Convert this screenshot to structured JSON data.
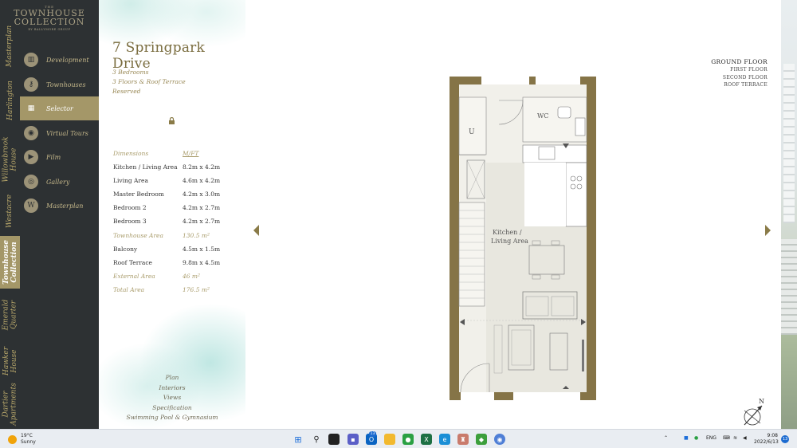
{
  "brand": {
    "top": "THE",
    "name_line1": "TOWNHOUSE",
    "name_line2": "COLLECTION",
    "byline": "BY BALLYMORE GROUP"
  },
  "rail": [
    {
      "label": "Masterplan"
    },
    {
      "label": "Harlington"
    },
    {
      "label": "Willowbrook House"
    },
    {
      "label": "Westacre"
    },
    {
      "label": "Townhouse Collection",
      "active": true
    },
    {
      "label": "Emerald Quarter"
    },
    {
      "label": "Hawker House"
    },
    {
      "label": "Dartier Apartments"
    }
  ],
  "menu": [
    {
      "label": "Development",
      "icon": "building-icon"
    },
    {
      "label": "Townhouses",
      "icon": "key-icon"
    },
    {
      "label": "Selector",
      "icon": "grid-icon",
      "active": true
    },
    {
      "label": "Virtual Tours",
      "icon": "vr-headset-icon"
    },
    {
      "label": "Film",
      "icon": "film-icon"
    },
    {
      "label": "Gallery",
      "icon": "camera-icon"
    },
    {
      "label": "Masterplan",
      "icon": "w-logo-icon"
    }
  ],
  "property": {
    "title": "7 Springpark Drive",
    "bedrooms": "3 Bedrooms",
    "floors": "3 Floors & Roof Terrace",
    "status": "Reserved"
  },
  "dimensions": {
    "header_key": "Dimensions",
    "header_val": "M/FT",
    "rows": [
      {
        "k": "Kitchen / Living Area",
        "v": "8.2m x 4.2m"
      },
      {
        "k": "Living Area",
        "v": "4.6m x 4.2m"
      },
      {
        "k": "Master Bedroom",
        "v": "4.2m x 3.0m"
      },
      {
        "k": "Bedroom 2",
        "v": "4.2m x 2.7m"
      },
      {
        "k": "Bedroom 3",
        "v": "4.2m x 2.7m"
      },
      {
        "k": "Townhouse Area",
        "v": "130.5 m²",
        "hl": true
      },
      {
        "k": "Balcony",
        "v": "4.5m x 1.5m"
      },
      {
        "k": "Roof Terrace",
        "v": "9.8m x 4.5m"
      },
      {
        "k": "External Area",
        "v": "46 m²",
        "hl": true
      },
      {
        "k": "Total Area",
        "v": "176.5 m²",
        "hl": true
      }
    ]
  },
  "links": [
    "Plan",
    "Interiors",
    "Views",
    "Specification",
    "Swimming Pool & Gymnasium"
  ],
  "floors": [
    "GROUND FLOOR",
    "FIRST FLOOR",
    "SECOND FLOOR",
    "ROOF TERRACE"
  ],
  "plan_labels": {
    "wc": "WC",
    "u": "U",
    "kitchen_line1": "Kitchen /",
    "kitchen_line2": "Living Area"
  },
  "compass_label": "N",
  "taskbar": {
    "temp": "19°C",
    "weather": "Sunny",
    "lang": "ENG",
    "time": "9:08",
    "date": "2022/6/13",
    "notifications": "13",
    "badge": "13"
  },
  "colors": {
    "gold": "#8a7b48",
    "dark": "#2d3133",
    "active": "#a49768"
  }
}
